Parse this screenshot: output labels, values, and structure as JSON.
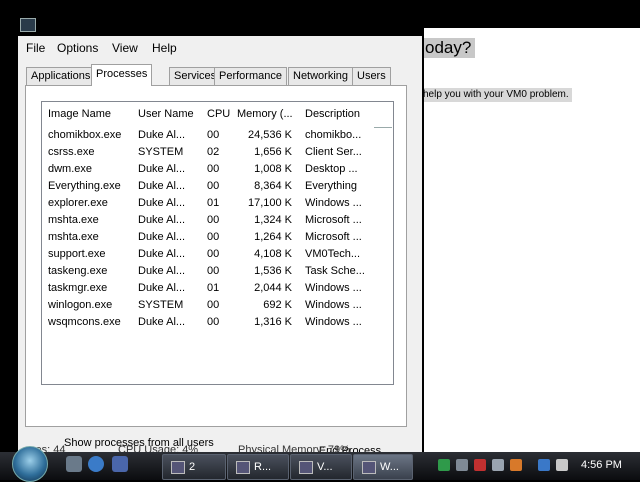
{
  "background_page": {
    "heading": "oday?",
    "line": "help you with your VM0 problem."
  },
  "task_manager": {
    "menu": [
      "File",
      "Options",
      "View",
      "Help"
    ],
    "tabs": [
      "Applications",
      "Processes",
      "Services",
      "Performance",
      "Networking",
      "Users"
    ],
    "active_tab": "Processes",
    "columns": {
      "image_name": "Image Name",
      "user_name": "User Name",
      "cpu": "CPU",
      "memory": "Memory (...",
      "description": "Description"
    },
    "processes": [
      {
        "name": "chomikbox.exe",
        "user": "Duke Al...",
        "cpu": "00",
        "mem": "24,536 K",
        "desc": "chomikbo..."
      },
      {
        "name": "csrss.exe",
        "user": "SYSTEM",
        "cpu": "02",
        "mem": "1,656 K",
        "desc": "Client Ser..."
      },
      {
        "name": "dwm.exe",
        "user": "Duke Al...",
        "cpu": "00",
        "mem": "1,008 K",
        "desc": "Desktop ..."
      },
      {
        "name": "Everything.exe",
        "user": "Duke Al...",
        "cpu": "00",
        "mem": "8,364 K",
        "desc": "Everything"
      },
      {
        "name": "explorer.exe",
        "user": "Duke Al...",
        "cpu": "01",
        "mem": "17,100 K",
        "desc": "Windows ..."
      },
      {
        "name": "mshta.exe",
        "user": "Duke Al...",
        "cpu": "00",
        "mem": "1,324 K",
        "desc": "Microsoft ..."
      },
      {
        "name": "mshta.exe",
        "user": "Duke Al...",
        "cpu": "00",
        "mem": "1,264 K",
        "desc": "Microsoft ..."
      },
      {
        "name": "support.exe",
        "user": "Duke Al...",
        "cpu": "00",
        "mem": "4,108 K",
        "desc": "VM0Tech..."
      },
      {
        "name": "taskeng.exe",
        "user": "Duke Al...",
        "cpu": "00",
        "mem": "1,536 K",
        "desc": "Task Sche..."
      },
      {
        "name": "taskmgr.exe",
        "user": "Duke Al...",
        "cpu": "01",
        "mem": "2,044 K",
        "desc": "Windows ..."
      },
      {
        "name": "winlogon.exe",
        "user": "SYSTEM",
        "cpu": "00",
        "mem": "692 K",
        "desc": "Windows ..."
      },
      {
        "name": "wsqmcons.exe",
        "user": "Duke Al...",
        "cpu": "00",
        "mem": "1,316 K",
        "desc": "Windows ..."
      }
    ],
    "show_all_label": "Show processes from all users",
    "end_process_label": "End Process",
    "status": {
      "processes": "ses: 44",
      "cpu_usage": "CPU Usage: 4%",
      "physical_memory": "Physical Memory: 79%"
    }
  },
  "taskbar": {
    "buttons": [
      {
        "label": "2",
        "icon": "folder-icon"
      },
      {
        "label": "R...",
        "icon": "run-icon"
      },
      {
        "label": "V...",
        "icon": "window-icon"
      },
      {
        "label": "W...",
        "icon": "task-manager-icon"
      }
    ],
    "clock": "4:56 PM"
  }
}
